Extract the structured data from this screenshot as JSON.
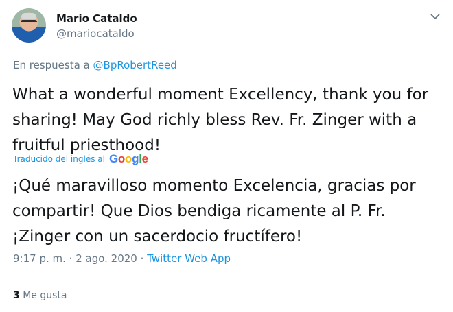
{
  "author": {
    "display_name": "Mario Cataldo",
    "handle": "@mariocataldo",
    "avatar_icon": "user-avatar"
  },
  "menu_icon": "chevron-down-icon",
  "reply": {
    "prefix": "En respuesta a",
    "mention": "@BpRobertReed"
  },
  "tweet": {
    "text": "What a wonderful moment Excellency, thank you for sharing! May God richly bless Rev. Fr. Zinger with a fruitful priesthood!"
  },
  "translation": {
    "label": "Traducido del inglés al",
    "provider": [
      "G",
      "o",
      "o",
      "g",
      "l",
      "e"
    ],
    "text": "¡Qué maravilloso momento Excelencia, gracias por compartir! Que Dios bendiga ricamente al P. Fr. ¡Zinger con un sacerdocio fructífero!"
  },
  "meta": {
    "timestamp": "9:17 p. m. · 2 ago. 2020",
    "separator": "·",
    "source": "Twitter Web App"
  },
  "stats": {
    "likes_count": "3",
    "likes_label": "Me gusta"
  },
  "colors": {
    "link": "#1b95e0",
    "secondary_text": "#657786",
    "primary_text": "#14171a"
  }
}
